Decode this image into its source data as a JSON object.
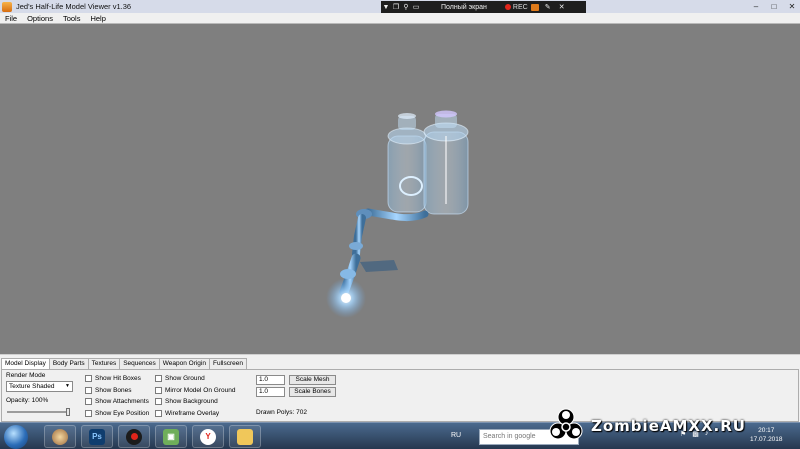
{
  "window": {
    "title": "Jed's Half-Life Model Viewer v1.36",
    "controls": [
      "minimize",
      "maximize",
      "close"
    ]
  },
  "recorder": {
    "fullscreen_label": "Полный экран",
    "rec_label": "REC"
  },
  "menu": [
    "File",
    "Options",
    "Tools",
    "Help"
  ],
  "tabs": [
    "Model Display",
    "Body Parts",
    "Textures",
    "Sequences",
    "Weapon Origin",
    "Fullscreen"
  ],
  "model_display": {
    "render_mode_label": "Render Mode",
    "render_mode_value": "Texture Shaded",
    "opacity_label": "Opacity: 100%",
    "opacity_value": 100,
    "checkboxes_col1": [
      "Show Hit Boxes",
      "Show Bones",
      "Show Attachments",
      "Show Eye Position"
    ],
    "checkboxes_col2": [
      "Show Ground",
      "Mirror Model On Ground",
      "Show Background",
      "Wireframe Overlay"
    ],
    "scale_mesh_value": "1.0",
    "scale_mesh_button": "Scale Mesh",
    "scale_bones_value": "1.0",
    "scale_bones_button": "Scale Bones",
    "drawn_polys": "Drawn Polys: 702"
  },
  "taskbar": {
    "lang": "RU",
    "search_placeholder": "Search in google",
    "clock_time": "20:17",
    "clock_date": "17.07.2018",
    "apps": [
      "explorer",
      "photoshop",
      "recorder",
      "monitor",
      "yandex",
      "folder"
    ]
  },
  "watermark": {
    "text": "ZombieAMXX.RU"
  },
  "colors": {
    "viewport_bg": "#7f7f7f",
    "model_glow": "#9fd3ff",
    "rec_red": "#e0251b"
  }
}
